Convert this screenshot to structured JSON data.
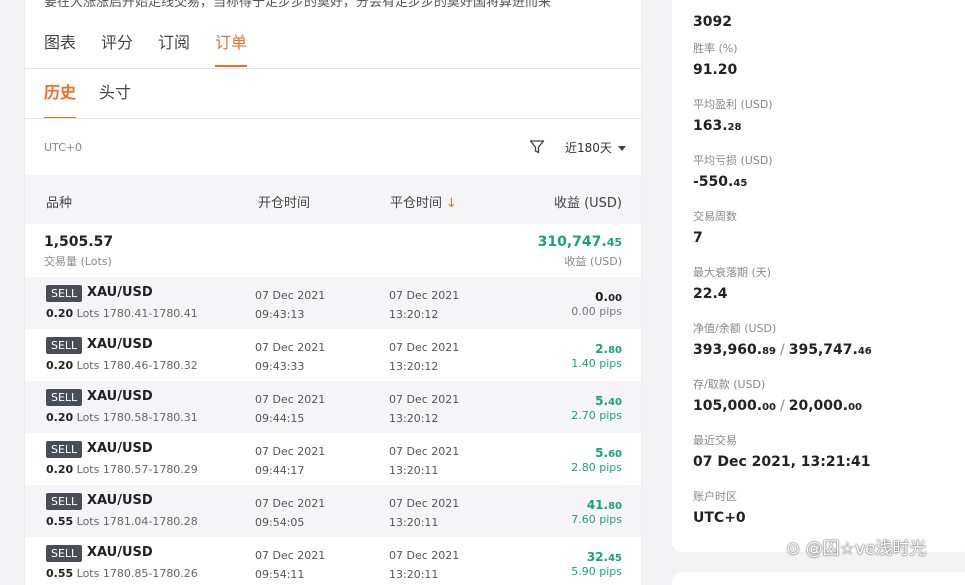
{
  "intro_text": "要在大涨涨启开始走线交易，当称得于走步步的莫好，分会有走步步的莫好国将算进而来",
  "top_tabs": [
    {
      "label": "图表",
      "active": false
    },
    {
      "label": "评分",
      "active": false
    },
    {
      "label": "订阅",
      "active": false
    },
    {
      "label": "订单",
      "active": true
    }
  ],
  "sub_tabs": [
    {
      "label": "历史",
      "active": true
    },
    {
      "label": "头寸",
      "active": false
    }
  ],
  "timezone_label": "UTC+0",
  "range_select": "近180天",
  "columns": {
    "symbol": "品种",
    "open_time": "开仓时间",
    "close_time": "平仓时间",
    "profit": "收益 (USD)"
  },
  "summary": {
    "lots": "1,505.57",
    "lots_label": "交易量 (Lots)",
    "profit_int": "310,747.",
    "profit_dec": "45",
    "profit_label": "收益 (USD)"
  },
  "orders": [
    {
      "side": "SELL",
      "symbol": "XAU/USD",
      "lots": "0.20",
      "lots_unit": "Lots",
      "price_range": "1780.41-1780.41",
      "open_date": "07 Dec 2021",
      "open_time": "09:43:13",
      "close_date": "07 Dec 2021",
      "close_time": "13:20:12",
      "pl_int": "0.",
      "pl_dec": "00",
      "pips": "0.00 pips",
      "status": "neutral"
    },
    {
      "side": "SELL",
      "symbol": "XAU/USD",
      "lots": "0.20",
      "lots_unit": "Lots",
      "price_range": "1780.46-1780.32",
      "open_date": "07 Dec 2021",
      "open_time": "09:43:33",
      "close_date": "07 Dec 2021",
      "close_time": "13:20:12",
      "pl_int": "2.",
      "pl_dec": "80",
      "pips": "1.40 pips",
      "status": "green"
    },
    {
      "side": "SELL",
      "symbol": "XAU/USD",
      "lots": "0.20",
      "lots_unit": "Lots",
      "price_range": "1780.58-1780.31",
      "open_date": "07 Dec 2021",
      "open_time": "09:44:15",
      "close_date": "07 Dec 2021",
      "close_time": "13:20:12",
      "pl_int": "5.",
      "pl_dec": "40",
      "pips": "2.70 pips",
      "status": "green"
    },
    {
      "side": "SELL",
      "symbol": "XAU/USD",
      "lots": "0.20",
      "lots_unit": "Lots",
      "price_range": "1780.57-1780.29",
      "open_date": "07 Dec 2021",
      "open_time": "09:44:17",
      "close_date": "07 Dec 2021",
      "close_time": "13:20:11",
      "pl_int": "5.",
      "pl_dec": "60",
      "pips": "2.80 pips",
      "status": "green"
    },
    {
      "side": "SELL",
      "symbol": "XAU/USD",
      "lots": "0.55",
      "lots_unit": "Lots",
      "price_range": "1781.04-1780.28",
      "open_date": "07 Dec 2021",
      "open_time": "09:54:05",
      "close_date": "07 Dec 2021",
      "close_time": "13:20:11",
      "pl_int": "41.",
      "pl_dec": "80",
      "pips": "7.60 pips",
      "status": "green"
    },
    {
      "side": "SELL",
      "symbol": "XAU/USD",
      "lots": "0.55",
      "lots_unit": "Lots",
      "price_range": "1780.85-1780.26",
      "open_date": "07 Dec 2021",
      "open_time": "09:54:11",
      "close_date": "07 Dec 2021",
      "close_time": "13:20:11",
      "pl_int": "32.",
      "pl_dec": "45",
      "pips": "5.90 pips",
      "status": "green"
    }
  ],
  "stats": {
    "trades_value": "3092",
    "win_rate": {
      "label": "胜率 (%)",
      "value": "91.20"
    },
    "avg_profit": {
      "label": "平均盈利 (USD)",
      "int": "163.",
      "dec": "28"
    },
    "avg_loss": {
      "label": "平均亏损 (USD)",
      "int": "-550.",
      "dec": "45"
    },
    "trading_weeks": {
      "label": "交易周数",
      "value": "7"
    },
    "max_drawdown_days": {
      "label": "最大衰落期 (天)",
      "value": "22.4"
    },
    "equity_balance": {
      "label": "净值/余额 (USD)",
      "a_int": "393,960.",
      "a_dec": "89",
      "b_int": "395,747.",
      "b_dec": "46"
    },
    "deposit_withdraw": {
      "label": "存/取款 (USD)",
      "a_int": "105,000.",
      "a_dec": "00",
      "b_int": "20,000.",
      "b_dec": "00"
    },
    "last_trade": {
      "label": "最近交易",
      "value": "07 Dec 2021, 13:21:41"
    },
    "account_tz": {
      "label": "账户时区",
      "value": "UTC+0"
    }
  },
  "watermark": "⊙ @囚☆ve浅时光",
  "colors": {
    "accent": "#f26b2c",
    "profit_green": "#1aa37a",
    "badge_bg": "#474d59"
  },
  "icons": {
    "filter": "filter-icon",
    "sort": "arrow-down-icon",
    "dropdown": "caret-down-icon"
  }
}
